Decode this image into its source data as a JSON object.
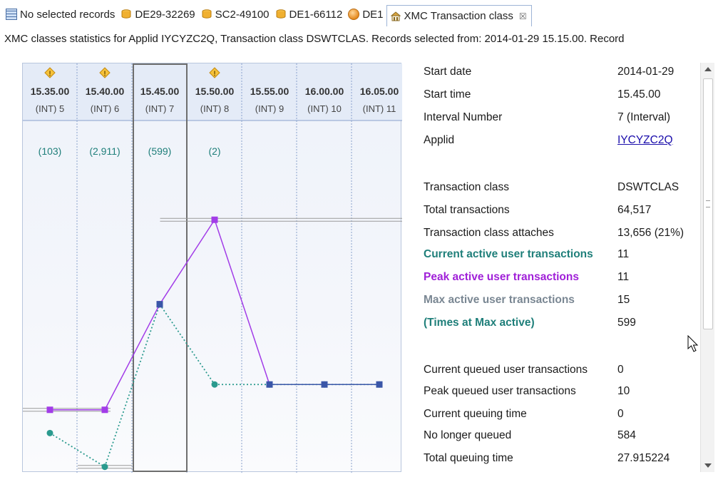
{
  "tabs": [
    {
      "label": "No selected records",
      "icon": "grid-icon",
      "active": false
    },
    {
      "label": "DE29-32269",
      "icon": "database-icon",
      "active": false
    },
    {
      "label": "SC2-49100",
      "icon": "database-icon",
      "active": false
    },
    {
      "label": "DE1-66112",
      "icon": "database-icon",
      "active": false
    },
    {
      "label": "DE1",
      "icon": "sphere-icon",
      "active": false
    },
    {
      "label": "XMC Transaction class",
      "icon": "transaction-icon",
      "active": true,
      "close": "☒"
    }
  ],
  "status_line": "XMC classes statistics for Applid IYCYZC2Q, Transaction class DSWTCLAS. Records selected from: 2014-01-29 15.15.00. Record",
  "chart_data": {
    "type": "line",
    "categories": [
      "15.35.00",
      "15.40.00",
      "15.45.00",
      "15.50.00",
      "15.55.00",
      "16.00.00",
      "16.05.00"
    ],
    "intervals": [
      "(INT) 5",
      "(INT) 6",
      "(INT) 7",
      "(INT) 8",
      "(INT) 9",
      "(INT) 10",
      "(INT) 11"
    ],
    "warnings": [
      true,
      true,
      false,
      true,
      false,
      false,
      false
    ],
    "counts": [
      "(103)",
      "(2,911)",
      "(599)",
      "(2)",
      "",
      "",
      ""
    ],
    "selected_index": 2,
    "ylim": [
      0,
      13
    ],
    "series": [
      {
        "color": "#a23ce8",
        "style": "solid",
        "values": [
          2,
          2,
          7,
          11,
          null,
          null,
          null
        ]
      },
      {
        "color": "#3a56a8",
        "style": "solid",
        "values": [
          null,
          null,
          7,
          null,
          3.2,
          3.2,
          3.2
        ]
      },
      {
        "color": "#2a9a8e",
        "style": "dotted",
        "values": [
          0.9,
          -0.7,
          7,
          3.2,
          3.2,
          3.2,
          3.2
        ]
      }
    ]
  },
  "details": {
    "rows": [
      {
        "label": "Start date",
        "value": "2014-01-29"
      },
      {
        "label": "Start time",
        "value": "15.45.00"
      },
      {
        "label": "Interval Number",
        "value": "7 (Interval)"
      },
      {
        "label": "Applid",
        "value": "IYCYZC2Q",
        "link": true
      },
      {
        "label": "Transaction class",
        "value": "DSWTCLAS"
      },
      {
        "label": "Total transactions",
        "value": "64,517"
      },
      {
        "label": "Transaction class attaches",
        "value": "13,656 (21%)"
      },
      {
        "label": "Current active user transactions",
        "value": "11",
        "color": "#1f7f7a",
        "bold": true
      },
      {
        "label": "Peak active user transactions",
        "value": "11",
        "color": "#a020d8",
        "bold": true
      },
      {
        "label": "Max active user transactions",
        "value": "15",
        "color": "#7a8793",
        "bold": true
      },
      {
        "label": "(Times at Max active)",
        "value": "599",
        "color": "#1f7f7a",
        "bold": true
      },
      {
        "label": "Current queued user transactions",
        "value": "0"
      },
      {
        "label": "Peak queued user transactions",
        "value": "10"
      },
      {
        "label": "Current queuing time",
        "value": "0"
      },
      {
        "label": "No longer queued",
        "value": "584"
      },
      {
        "label": "Total queuing time",
        "value": "27.915224"
      }
    ]
  },
  "colors": {
    "accent": "#4a6fa5",
    "teal": "#2a9a8e",
    "purple": "#a23ce8",
    "blue_marker": "#3a56a8",
    "warning": "#f0a020"
  }
}
